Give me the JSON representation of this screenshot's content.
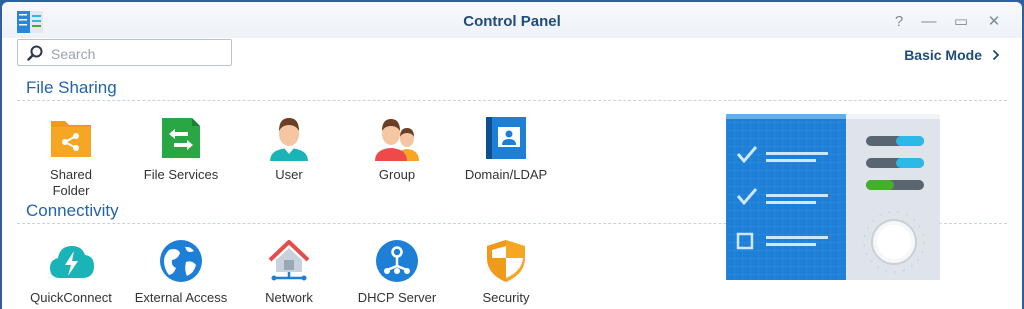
{
  "window": {
    "title": "Control Panel",
    "help_glyph": "?",
    "minimize_glyph": "—",
    "maximize_glyph": "▭",
    "close_glyph": "✕"
  },
  "search": {
    "placeholder": "Search"
  },
  "mode": {
    "label": "Basic Mode",
    "chevron": "›"
  },
  "sections": {
    "file_sharing": {
      "title": "File Sharing",
      "items": {
        "shared_folder": {
          "label_line1": "Shared",
          "label_line2": "Folder",
          "icon": "shared-folder-icon"
        },
        "file_services": {
          "label": "File Services",
          "icon": "file-services-icon"
        },
        "user": {
          "label": "User",
          "icon": "user-icon"
        },
        "group": {
          "label": "Group",
          "icon": "group-icon"
        },
        "domain_ldap": {
          "label": "Domain/LDAP",
          "icon": "domain-ldap-icon"
        }
      }
    },
    "connectivity": {
      "title": "Connectivity",
      "items": {
        "quickconnect": {
          "label": "QuickConnect",
          "icon": "quickconnect-icon"
        },
        "external_access": {
          "label": "External Access",
          "icon": "external-access-icon"
        },
        "network": {
          "label": "Network",
          "icon": "network-icon"
        },
        "dhcp_server": {
          "label": "DHCP Server",
          "icon": "dhcp-server-icon"
        },
        "security": {
          "label": "Security",
          "icon": "security-icon"
        }
      }
    }
  },
  "colors": {
    "accent": "#1f64ad",
    "title": "#1f4c79",
    "orange": "#f5a623",
    "green": "#29a745",
    "blue": "#1e7fd6",
    "teal": "#19b3b8"
  }
}
